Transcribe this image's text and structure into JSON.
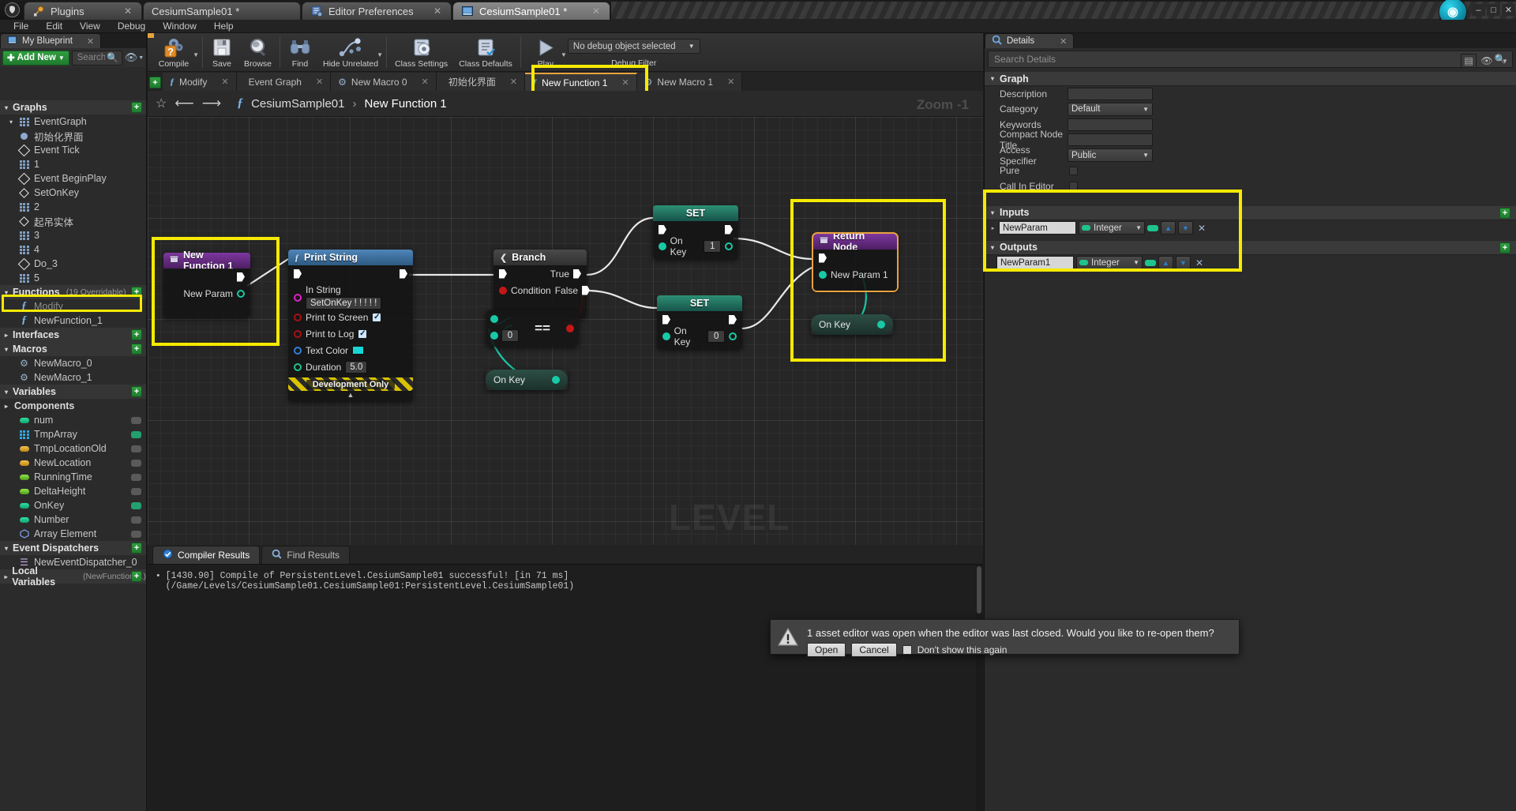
{
  "window": {
    "app_logo": "unreal-logo",
    "tabs": [
      {
        "label": "Plugins",
        "icon": "plug-icon",
        "active": false,
        "closable": true
      },
      {
        "label": "CesiumSample01 *",
        "icon": "none",
        "active": false,
        "closable": false
      },
      {
        "label": "Editor Preferences",
        "icon": "preferences-icon",
        "active": false,
        "closable": true
      },
      {
        "label": "CesiumSample01 *",
        "icon": "blueprint-book-icon",
        "active": true,
        "closable": true
      }
    ],
    "controls": {
      "minimize": "–",
      "maximize": "□",
      "close": "✕"
    }
  },
  "menubar": {
    "items": [
      "File",
      "Edit",
      "View",
      "Debug",
      "Window",
      "Help"
    ]
  },
  "sidebar": {
    "tab_label": "My Blueprint",
    "tab_icon": "blueprint-book-icon",
    "add_new_label": "Add New",
    "search_placeholder": "Search",
    "search_value": "",
    "sections": [
      {
        "title": "Graphs",
        "expanded": true,
        "has_add": true,
        "items": [
          {
            "label": "EventGraph",
            "icon": "graph-icon",
            "indent": 0,
            "expanded": true
          },
          {
            "label": "初始化界面",
            "icon": "event-dot-icon",
            "indent": 1
          },
          {
            "label": "Event Tick",
            "icon": "event-diamond-icon",
            "indent": 1
          },
          {
            "label": "1",
            "icon": "graph-icon",
            "indent": 1
          },
          {
            "label": "Event BeginPlay",
            "icon": "event-diamond-icon",
            "indent": 1
          },
          {
            "label": "SetOnKey",
            "icon": "event-diamond-icon",
            "indent": 1
          },
          {
            "label": "2",
            "icon": "graph-icon",
            "indent": 1
          },
          {
            "label": "起吊实体",
            "icon": "event-diamond-icon",
            "indent": 1
          },
          {
            "label": "3",
            "icon": "graph-icon",
            "indent": 1
          },
          {
            "label": "4",
            "icon": "graph-icon",
            "indent": 1
          },
          {
            "label": "Do_3",
            "icon": "event-diamond-icon",
            "indent": 1
          },
          {
            "label": "5",
            "icon": "graph-icon",
            "indent": 1
          }
        ]
      },
      {
        "title": "Functions",
        "count_label": "(19 Overridable)",
        "expanded": true,
        "has_add": true,
        "items": [
          {
            "label": "Modify",
            "icon": "function-icon",
            "indent": 0,
            "dim": true
          },
          {
            "label": "NewFunction_1",
            "icon": "function-icon",
            "indent": 0,
            "highlighted": true
          }
        ]
      },
      {
        "title": "Interfaces",
        "expanded": false,
        "has_add": true,
        "items": []
      },
      {
        "title": "Macros",
        "expanded": true,
        "has_add": true,
        "items": [
          {
            "label": "NewMacro_0",
            "icon": "macro-gear-icon",
            "indent": 0
          },
          {
            "label": "NewMacro_1",
            "icon": "macro-gear-icon",
            "indent": 0
          }
        ]
      },
      {
        "title": "Variables",
        "expanded": true,
        "has_add": true,
        "items": [
          {
            "label": "Components",
            "icon": "none",
            "indent": 0,
            "collapsed_group": true,
            "bold": true
          },
          {
            "label": "num",
            "icon": "var-pin-icon",
            "color": "#1ec48c",
            "indent": 1,
            "end_icon": "grey"
          },
          {
            "label": "TmpArray",
            "icon": "array-icon",
            "color": "#2aa9e0",
            "indent": 1,
            "end_icon": "green"
          },
          {
            "label": "TmpLocationOld",
            "icon": "var-pin-icon",
            "color": "#dca02a",
            "indent": 1,
            "end_icon": "grey"
          },
          {
            "label": "NewLocation",
            "icon": "var-pin-icon",
            "color": "#dca02a",
            "indent": 1,
            "end_icon": "grey"
          },
          {
            "label": "RunningTime",
            "icon": "var-pin-icon",
            "color": "#6fcf2a",
            "indent": 1,
            "end_icon": "grey"
          },
          {
            "label": "DeltaHeight",
            "icon": "var-pin-icon",
            "color": "#6fcf2a",
            "indent": 1,
            "end_icon": "grey"
          },
          {
            "label": "OnKey",
            "icon": "var-pin-icon",
            "color": "#1ec48c",
            "indent": 1,
            "end_icon": "green"
          },
          {
            "label": "Number",
            "icon": "var-pin-icon",
            "color": "#1ec48c",
            "indent": 1,
            "end_icon": "grey"
          },
          {
            "label": "Array Element",
            "icon": "var-struct-icon",
            "color": "#6a8fd0",
            "indent": 1,
            "end_icon": "grey"
          }
        ]
      },
      {
        "title": "Event Dispatchers",
        "expanded": true,
        "has_add": true,
        "items": [
          {
            "label": "NewEventDispatcher_0",
            "icon": "dispatcher-icon",
            "indent": 0
          }
        ]
      },
      {
        "title": "Local Variables",
        "count_label": "(NewFunction_1)",
        "expanded": false,
        "has_add": true,
        "items": []
      }
    ]
  },
  "toolbar": {
    "items": [
      {
        "label": "Compile",
        "icon": "compile-question-gear-icon",
        "has_caret": true
      },
      {
        "label": "Save",
        "icon": "save-floppy-icon",
        "has_caret": false
      },
      {
        "label": "Browse",
        "icon": "browse-magnifier-icon",
        "has_caret": false
      },
      {
        "label": "Find",
        "icon": "find-binoculars-icon",
        "has_caret": false
      },
      {
        "label": "Hide Unrelated",
        "icon": "hide-unrelated-graph-icon",
        "has_caret": true
      },
      {
        "label": "Class Settings",
        "icon": "class-settings-gear-icon",
        "has_caret": false
      },
      {
        "label": "Class Defaults",
        "icon": "class-defaults-icon",
        "has_caret": false
      },
      {
        "label": "Play",
        "icon": "play-triangle-icon",
        "has_caret": true
      }
    ],
    "debug": {
      "combo_value": "No debug object selected",
      "label": "Debug Filter"
    }
  },
  "graph_tabs": {
    "add_label": "+",
    "tabs": [
      {
        "label": "Modify",
        "icon": "function-icon",
        "active": false
      },
      {
        "label": "Event Graph",
        "icon": "graph-icon",
        "active": false
      },
      {
        "label": "New Macro 0",
        "icon": "macro-gear-icon",
        "active": false
      },
      {
        "label": "初始化界面",
        "icon": "graph-icon",
        "active": false
      },
      {
        "label": "New Function 1",
        "icon": "function-icon",
        "active": true,
        "highlighted": true
      },
      {
        "label": "New Macro 1",
        "icon": "macro-gear-icon",
        "active": false
      }
    ]
  },
  "breadcrumb": {
    "star_icon": "favorite-star-icon",
    "back_icon": "back-arrow-icon",
    "forward_icon": "forward-arrow-icon",
    "fx_icon": "function-icon",
    "root": "CesiumSample01",
    "separator": "›",
    "current": "New Function 1",
    "zoom_label": "Zoom -1"
  },
  "canvas": {
    "watermark": "LEVEL BLUEPRINT",
    "nodes": [
      {
        "id": "entry",
        "title": "New Function 1",
        "icon": "function-entry-icon",
        "header_color": "#6b2f8a",
        "out_pin_label": "New Param",
        "highlighted": true
      },
      {
        "id": "print_string",
        "title": "Print String",
        "icon": "function-icon",
        "header_color": "#3d6fa0",
        "pins": [
          {
            "label": "In String",
            "value": "SetOnKey ! ! ! ! !",
            "pin_color": "magenta",
            "kind": "string"
          },
          {
            "label": "Print to Screen",
            "checked": true,
            "pin_color": "red",
            "kind": "bool"
          },
          {
            "label": "Print to Log",
            "checked": true,
            "pin_color": "red",
            "kind": "bool"
          },
          {
            "label": "Text Color",
            "swatch": "#18d6d6",
            "pin_color": "blue",
            "kind": "color"
          },
          {
            "label": "Duration",
            "value": "5.0",
            "pin_color": "green",
            "kind": "float"
          }
        ],
        "footer": "Development Only"
      },
      {
        "id": "branch",
        "title": "Branch",
        "icon": "branch-icon",
        "header_color": "#3a3a3a",
        "pins": [
          {
            "label": "True",
            "side": "out"
          },
          {
            "label": "Condition",
            "side": "in",
            "pin_color": "red"
          },
          {
            "label": "False",
            "side": "out"
          }
        ]
      },
      {
        "id": "equal",
        "title": "",
        "operator": "==",
        "value": "0",
        "header_color": "#2d2d2d"
      },
      {
        "id": "onkey_get_a",
        "title": "On Key",
        "kind": "variable-get"
      },
      {
        "id": "set_1",
        "title": "SET",
        "header_color": "#1f6a56",
        "pin_label": "On Key",
        "value": "1"
      },
      {
        "id": "set_0",
        "title": "SET",
        "header_color": "#1f6a56",
        "pin_label": "On Key",
        "value": "0"
      },
      {
        "id": "return_node",
        "title": "Return Node",
        "icon": "return-node-icon",
        "header_color": "#6b2f8a",
        "pin_label": "New Param 1",
        "selected": true,
        "highlighted": true
      },
      {
        "id": "onkey_get_b",
        "title": "On Key",
        "kind": "variable-get"
      }
    ]
  },
  "results": {
    "tabs": [
      {
        "label": "Compiler Results",
        "icon": "compiler-results-icon",
        "active": true
      },
      {
        "label": "Find Results",
        "icon": "find-results-icon",
        "active": false
      }
    ],
    "log_lines": [
      "[1430.90] Compile of PersistentLevel.CesiumSample01 successful! [in 71 ms] (/Game/Levels/CesiumSample01.CesiumSample01:PersistentLevel.CesiumSample01)"
    ]
  },
  "details": {
    "tab_label": "Details",
    "tab_icon": "details-magnifier-icon",
    "search_placeholder": "Search Details",
    "search_value": "",
    "search_icon": "search-icon",
    "grid_view_icon": "grid-view-icon",
    "eye_icon": "eye-icon",
    "sections": [
      {
        "title": "Graph",
        "expanded": true,
        "has_add": false,
        "properties": [
          {
            "label": "Description",
            "type": "text",
            "value": ""
          },
          {
            "label": "Category",
            "type": "select",
            "value": "Default"
          },
          {
            "label": "Keywords",
            "type": "text",
            "value": ""
          },
          {
            "label": "Compact Node Title",
            "type": "text",
            "value": ""
          },
          {
            "label": "Access Specifier",
            "type": "select",
            "value": "Public"
          },
          {
            "label": "Pure",
            "type": "checkbox",
            "value": false
          },
          {
            "label": "Call In Editor",
            "type": "checkbox",
            "value": false
          }
        ]
      },
      {
        "title": "Inputs",
        "expanded": true,
        "has_add": true,
        "params": [
          {
            "name": "NewParam",
            "type": "Integer",
            "type_color": "#1ec48c"
          }
        ]
      },
      {
        "title": "Outputs",
        "expanded": true,
        "has_add": true,
        "params": [
          {
            "name": "NewParam1",
            "type": "Integer",
            "type_color": "#1ec48c"
          }
        ]
      }
    ],
    "highlight_color": "#f6ea00"
  },
  "toast": {
    "icon": "warning-triangle-icon",
    "message": "1 asset editor was open when the editor was last closed. Would you like to re-open them?",
    "open_label": "Open",
    "cancel_label": "Cancel",
    "dont_show_label": "Don't show this again",
    "dont_show_checked": false
  }
}
